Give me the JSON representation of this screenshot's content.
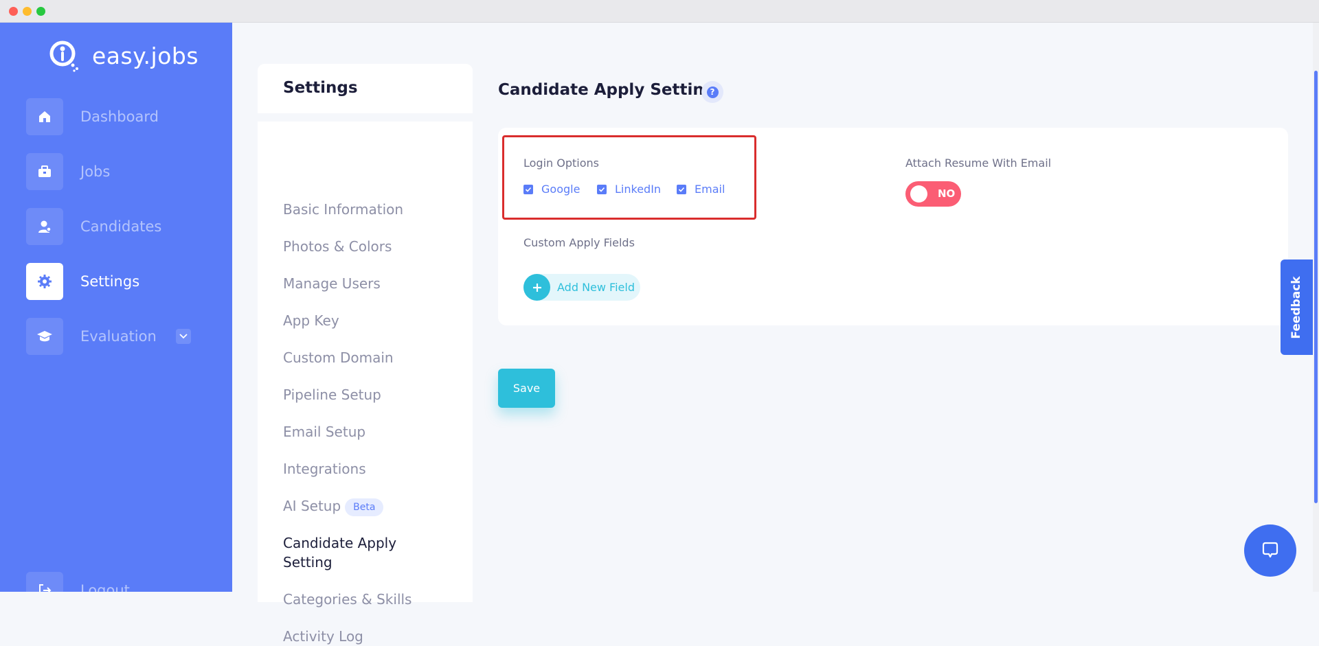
{
  "app": {
    "name": "easy.jobs"
  },
  "sidebar": {
    "items": [
      {
        "label": "Dashboard",
        "icon": "home-icon"
      },
      {
        "label": "Jobs",
        "icon": "briefcase-icon"
      },
      {
        "label": "Candidates",
        "icon": "user-icon"
      },
      {
        "label": "Settings",
        "icon": "gear-icon",
        "active": true
      },
      {
        "label": "Evaluation",
        "icon": "graduation-cap-icon",
        "has_dropdown": true
      }
    ],
    "logout_label": "Logout"
  },
  "settings_menu": {
    "title": "Settings",
    "items": [
      "Basic Information",
      "Photos & Colors",
      "Manage Users",
      "App Key",
      "Custom Domain",
      "Pipeline Setup",
      "Email Setup",
      "Integrations",
      "AI Setup",
      "Candidate Apply Setting",
      "Categories & Skills",
      "Activity Log"
    ],
    "beta_badge": "Beta",
    "active_item": "Candidate Apply Setting"
  },
  "main": {
    "title": "Candidate Apply Setting",
    "help_icon": "question-icon",
    "login_options": {
      "label": "Login Options",
      "options": [
        {
          "label": "Google",
          "checked": true
        },
        {
          "label": "LinkedIn",
          "checked": true
        },
        {
          "label": "Email",
          "checked": true
        }
      ]
    },
    "attach_resume": {
      "label": "Attach Resume With Email",
      "toggle_text": "NO",
      "enabled": false
    },
    "custom_fields": {
      "label": "Custom Apply Fields",
      "add_button": "Add New Field"
    },
    "save_button": "Save"
  },
  "feedback_tab": "Feedback",
  "colors": {
    "sidebar": "#5a7cf8",
    "accent": "#2ebfdb",
    "toggle_off": "#fb5d74",
    "highlight_border": "#d92d2d"
  }
}
